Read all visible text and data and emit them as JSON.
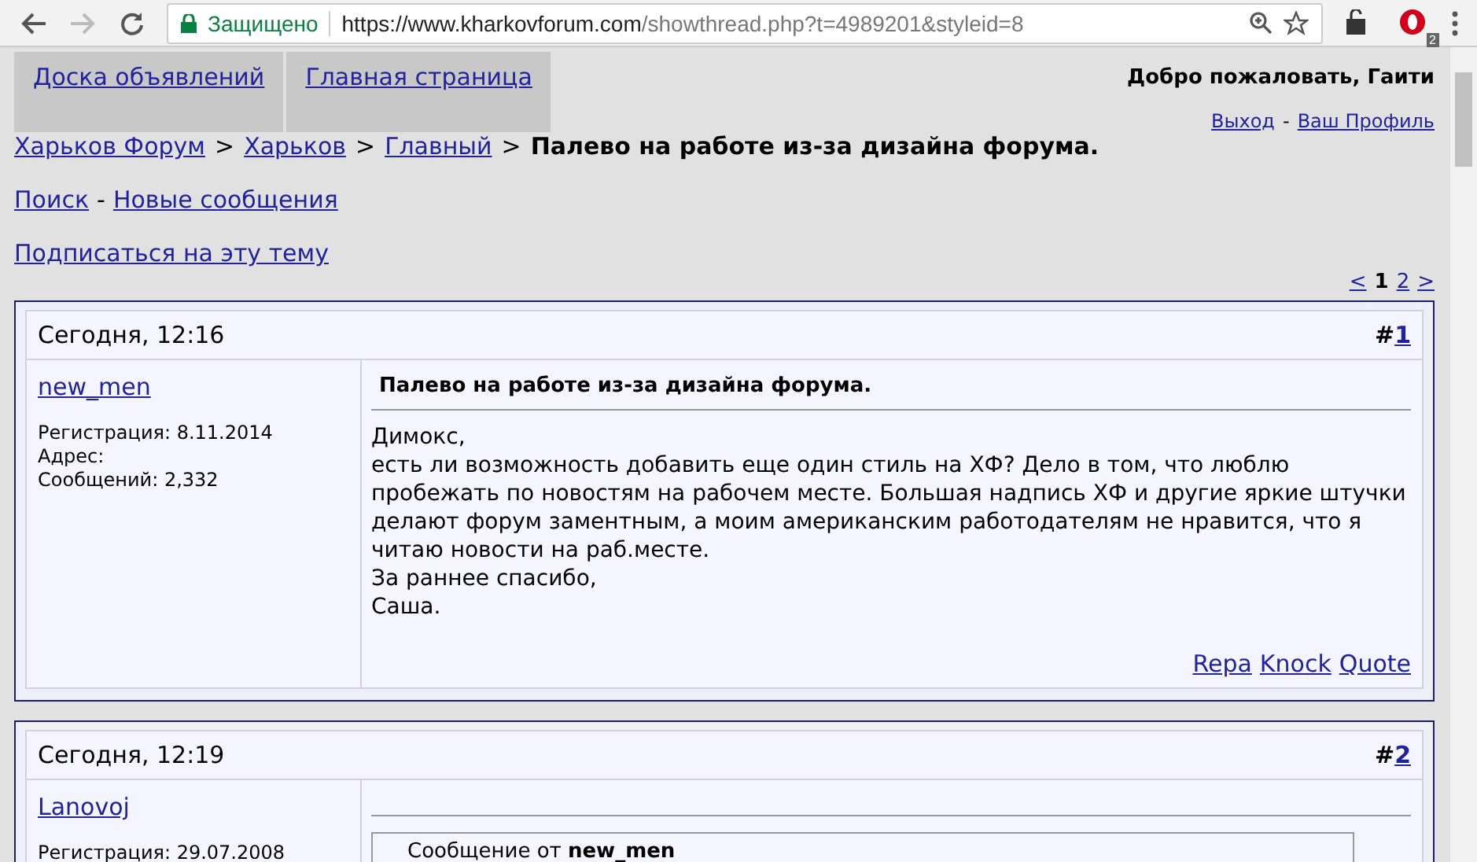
{
  "browser": {
    "security_label": "Защищено",
    "url_host": "https://www.kharkovforum.com",
    "url_path": "/showthread.php?t=4989201&styleid=8",
    "extension_badge": "2"
  },
  "nav_tabs": [
    "Доска объявлений",
    "Главная страница"
  ],
  "welcome": "Добро пожаловать, Гаити",
  "user_links": {
    "items": [
      "Выход",
      "Ваш Профиль"
    ],
    "separator": "-"
  },
  "breadcrumb": {
    "links": [
      "Харьков Форум",
      "Харьков",
      "Главный"
    ],
    "separator": ">",
    "current": "Палево на работе из-за дизайна форума."
  },
  "quick_links": {
    "items": [
      "Поиск",
      "Новые сообщения"
    ],
    "separator": "-"
  },
  "subscribe_link": "Подписаться на эту тему",
  "pagination": {
    "prev": "<",
    "pages": [
      {
        "label": "1",
        "selected": true
      },
      {
        "label": "2",
        "selected": false
      }
    ],
    "next": ">"
  },
  "posts": [
    {
      "date": "Сегодня, 12:16",
      "number_prefix": "#",
      "number": "1",
      "author": "new_men",
      "user_info": [
        "Регистрация: 8.11.2014",
        "Адрес:",
        "Сообщений: 2,332"
      ],
      "title": "Палево на работе из-за дизайна форума.",
      "body": [
        "Димокс,",
        "есть ли возможность добавить еще один стиль на ХФ? Дело в том, что люблю пробежать по новостям на рабочем месте. Большая надпись ХФ и другие яркие штучки делают форум заментным, а моим американским работодателям не нравится, что я читаю новости на раб.месте.",
        "За раннее спасибо,",
        "Саша."
      ],
      "actions": [
        "Repa",
        "Knock",
        "Quote"
      ]
    },
    {
      "date": "Сегодня, 12:19",
      "number_prefix": "#",
      "number": "2",
      "author": "Lanovoj",
      "user_info": [
        "Регистрация: 29.07.2008"
      ],
      "quote": {
        "label": "Сообщение от",
        "author": "new_men"
      }
    }
  ]
}
